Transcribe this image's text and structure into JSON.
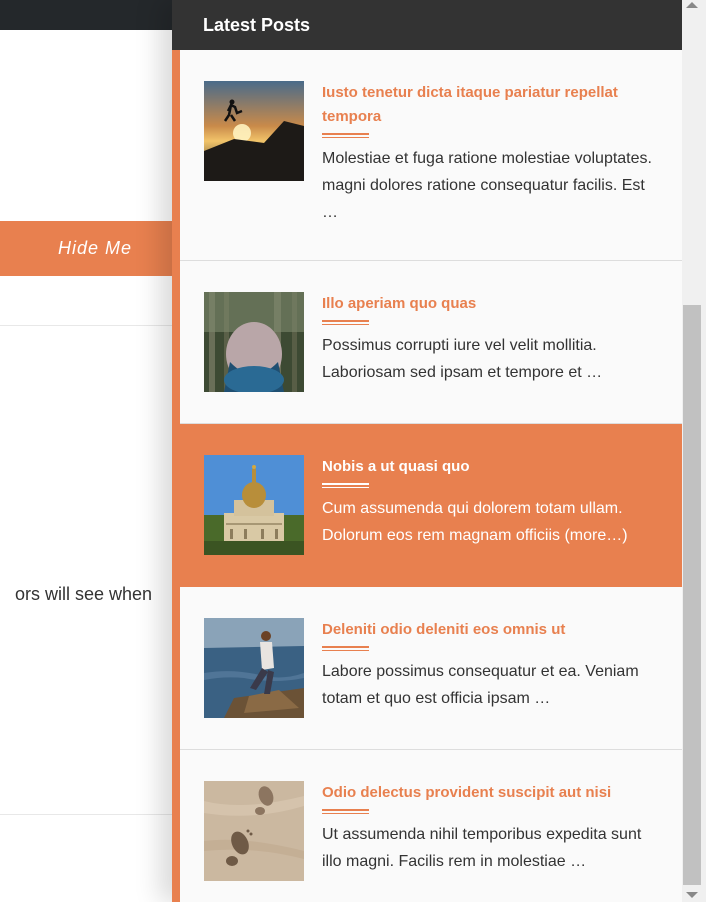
{
  "background": {
    "hide_me_label": "Hide Me",
    "partial_text": "ors will see when"
  },
  "panel": {
    "title": "Latest Posts",
    "posts": [
      {
        "title": "Iusto tenetur dicta itaque pariatur repellat tempora",
        "excerpt": "Molestiae et fuga ratione molestiae voluptates. magni dolores ratione consequatur facilis. Est …",
        "thumbnail": "sunset-silhouette-jump"
      },
      {
        "title": "Illo aperiam quo quas",
        "excerpt": "Possimus corrupti iure vel velit mollitia. Laboriosam sed ipsam et tempore et …",
        "thumbnail": "person-in-forest"
      },
      {
        "title": "Nobis a ut quasi quo",
        "excerpt": "Cum assumenda qui dolorem totam ullam. Dolorum eos rem magnam officiis (more…)",
        "thumbnail": "domed-palace",
        "active": true
      },
      {
        "title": "Deleniti odio deleniti eos omnis ut",
        "excerpt": "Labore possimus consequatur et ea. Veniam totam et quo est officia ipsam …",
        "thumbnail": "woman-on-rock-by-sea"
      },
      {
        "title": "Odio delectus provident suscipit aut nisi",
        "excerpt": "Ut assumenda nihil temporibus expedita sunt illo magni. Facilis rem in molestiae …",
        "thumbnail": "footprints-in-sand"
      }
    ]
  },
  "colors": {
    "accent": "#e8804f",
    "header_bg": "#333333",
    "topbar_bg": "#24282b"
  }
}
